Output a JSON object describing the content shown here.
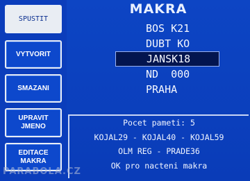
{
  "title": "MAKRA",
  "sidebar": {
    "buttons": [
      {
        "label": "SPUSTIT",
        "active": true
      },
      {
        "label": "VYTVORIT",
        "active": false
      },
      {
        "label": "SMAZANI",
        "active": false
      },
      {
        "label": "UPRAVIT\nJMENO",
        "active": false
      },
      {
        "label": "EDITACE\nMAKRA",
        "active": false
      }
    ]
  },
  "macros": {
    "items": [
      "BOS K21",
      "DUBT KO",
      "JANSK18",
      "ND  000",
      "PRAHA"
    ],
    "selected_index": 2
  },
  "info": {
    "memory_count": "Pocet pameti: 5",
    "line2": "KOJAL29 - KOJAL40 - KOJAL59",
    "line3": "OLM REG - PRADE36",
    "line4": "OK pro nacteni makra"
  },
  "watermark": "PARABOLA.CZ",
  "colors": {
    "background": "#0d45c4",
    "selected_item_bg": "#03154f",
    "active_button_bg": "#e9edf3"
  }
}
